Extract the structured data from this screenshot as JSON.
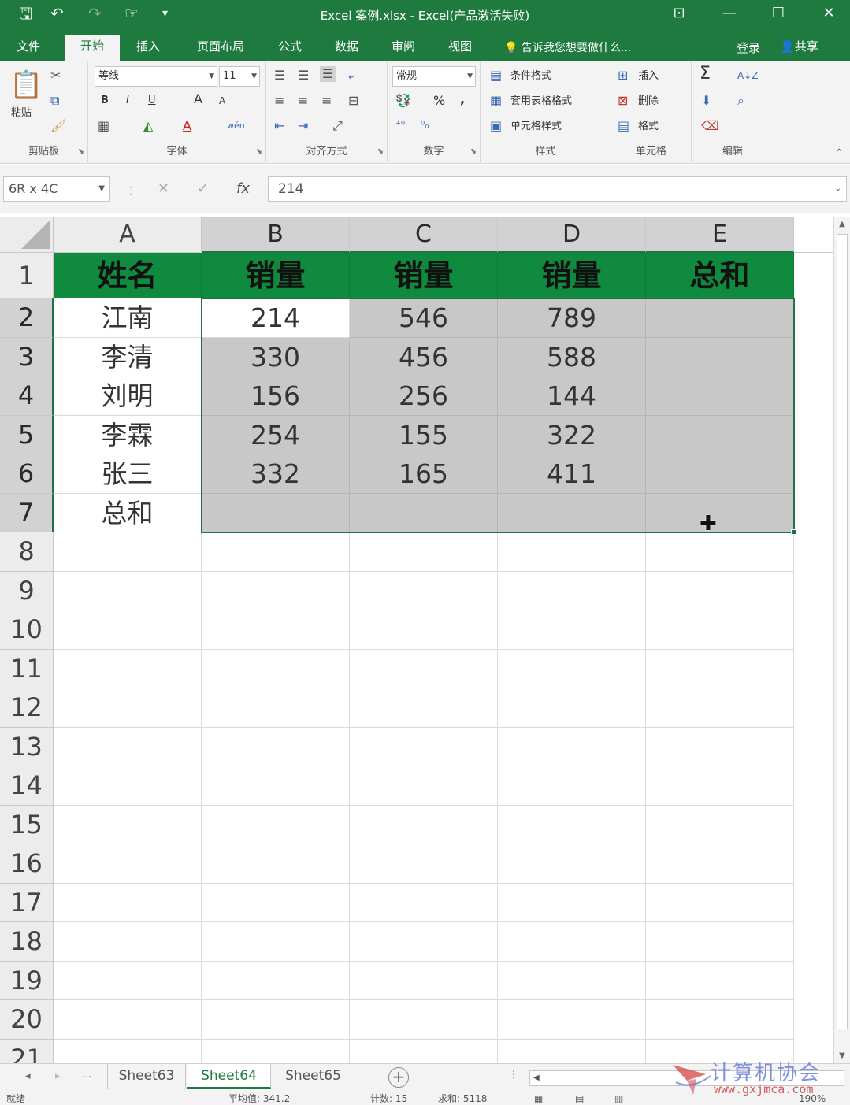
{
  "window": {
    "title": "Excel 案例.xlsx - Excel(产品激活失败)",
    "minimize": "—",
    "restore": "☐",
    "close": "✕",
    "ribbon_display": "⊡"
  },
  "quick_access": {
    "save": "🖫",
    "undo": "↶",
    "redo": "↷",
    "touch": "☞",
    "customize": "▾"
  },
  "ribbon_tabs": [
    {
      "label": "文件",
      "active": false
    },
    {
      "label": "开始",
      "active": true
    },
    {
      "label": "插入",
      "active": false
    },
    {
      "label": "页面布局",
      "active": false
    },
    {
      "label": "公式",
      "active": false
    },
    {
      "label": "数据",
      "active": false
    },
    {
      "label": "审阅",
      "active": false
    },
    {
      "label": "视图",
      "active": false
    }
  ],
  "tell_me": "告诉我您想要做什么...",
  "signin": "登录",
  "share": "共享",
  "ribbon": {
    "clipboard": {
      "label": "剪贴板",
      "paste": "粘贴"
    },
    "font": {
      "label": "字体",
      "font_name": "等线",
      "font_size": "11",
      "bold": "B",
      "italic": "I",
      "underline": "U",
      "grow": "A",
      "shrink": "A",
      "font_color": "A",
      "phonetic": "wén"
    },
    "alignment": {
      "label": "对齐方式"
    },
    "number": {
      "label": "数字",
      "format": "常规",
      "percent": "%",
      "comma": ","
    },
    "styles": {
      "label": "样式",
      "conditional": "条件格式",
      "table": "套用表格格式",
      "cell_styles": "单元格样式"
    },
    "cells": {
      "label": "单元格",
      "insert": "插入",
      "delete": "删除",
      "format": "格式"
    },
    "editing": {
      "label": "编辑",
      "sum": "Σ",
      "sort": "A↓Z",
      "find": "⌕"
    }
  },
  "formula_bar": {
    "name_box": "6R x 4C",
    "cancel": "✕",
    "enter": "✓",
    "fx": "fx",
    "value": "214"
  },
  "grid": {
    "columns": [
      "A",
      "B",
      "C",
      "D",
      "E"
    ],
    "selected_columns": [
      "B",
      "C",
      "D",
      "E"
    ],
    "rows": [
      "1",
      "2",
      "3",
      "4",
      "5",
      "6",
      "7",
      "8",
      "9",
      "10",
      "11",
      "12",
      "13",
      "14",
      "15",
      "16",
      "17",
      "18",
      "19",
      "20",
      "21"
    ],
    "selected_rows": [
      "2",
      "3",
      "4",
      "5",
      "6",
      "7"
    ],
    "header_row": [
      "姓名",
      "销量",
      "销量",
      "销量",
      "总和"
    ],
    "data_rows": [
      [
        "江南",
        "214",
        "546",
        "789",
        ""
      ],
      [
        "李清",
        "330",
        "456",
        "588",
        ""
      ],
      [
        "刘明",
        "156",
        "256",
        "144",
        ""
      ],
      [
        "李霖",
        "254",
        "155",
        "322",
        ""
      ],
      [
        "张三",
        "332",
        "165",
        "411",
        ""
      ],
      [
        "总和",
        "",
        "",
        "",
        ""
      ]
    ],
    "active_cell": "B2",
    "header_fill": "#108a3e",
    "selection_color": "#217346"
  },
  "sheet_tabs": {
    "nav_prev": "◂",
    "nav_next": "▸",
    "more": "...",
    "tabs": [
      {
        "label": "Sheet63",
        "active": false
      },
      {
        "label": "Sheet64",
        "active": true
      },
      {
        "label": "Sheet65",
        "active": false
      }
    ],
    "add": "+"
  },
  "status_bar": {
    "ready": "就绪",
    "average": "平均值: 341.2",
    "count": "计数: 15",
    "sum": "求和: 5118",
    "zoom": "190%"
  },
  "watermark": {
    "title": "计算机协会",
    "url": "www.gxjmca.com"
  }
}
